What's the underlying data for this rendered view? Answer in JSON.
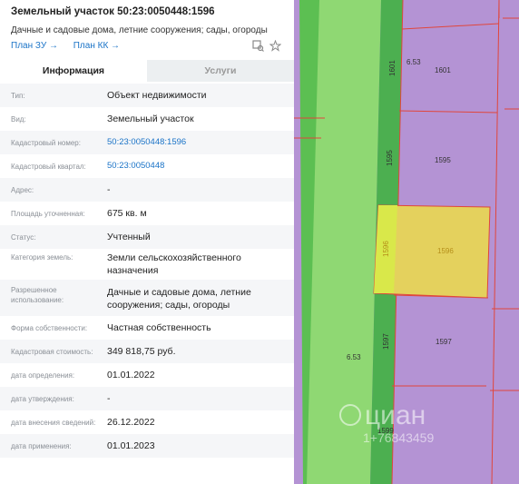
{
  "header": {
    "title": "Земельный участок 50:23:0050448:1596",
    "subtitle": "Дачные и садовые дома, летние сооружения; сады, огороды",
    "links": [
      "План ЗУ →",
      "План КК →"
    ]
  },
  "tabs": [
    {
      "label": "Информация",
      "active": true
    },
    {
      "label": "Услуги",
      "active": false
    }
  ],
  "rows": [
    {
      "label": "Тип:",
      "value": "Объект недвижимости"
    },
    {
      "label": "Вид:",
      "value": "Земельный участок"
    },
    {
      "label": "Кадастровый номер:",
      "value": "50:23:0050448:1596",
      "link": true
    },
    {
      "label": "Кадастровый квартал:",
      "value": "50:23:0050448",
      "link": true
    },
    {
      "label": "Адрес:",
      "value": "-"
    },
    {
      "label": "Площадь уточненная:",
      "value": "675 кв. м"
    },
    {
      "label": "Статус:",
      "value": "Учтенный"
    },
    {
      "label": "Категория земель:",
      "value": "Земли сельскохозяйственного назначения"
    },
    {
      "label": "Разрешенное использование:",
      "value": "Дачные и садовые дома, летние сооружения; сады, огороды"
    },
    {
      "label": "Форма собственности:",
      "value": "Частная собственность"
    },
    {
      "label": "Кадастровая стоимость:",
      "value": "349 818,75 руб."
    },
    {
      "label": "дата определения:",
      "value": "01.01.2022"
    },
    {
      "label": "дата утверждения:",
      "value": "-"
    },
    {
      "label": "дата внесения сведений:",
      "value": "26.12.2022"
    },
    {
      "label": "дата применения:",
      "value": "01.01.2023"
    }
  ],
  "map": {
    "parcels": [
      {
        "number": "1601",
        "side": "1601"
      },
      {
        "number": "1595",
        "side": "1595"
      },
      {
        "number": "1596",
        "side": "1596",
        "selected": true
      },
      {
        "number": "1597",
        "side": "1597"
      },
      {
        "number": "1599",
        "side": "1599"
      }
    ],
    "road_width_labels": [
      "6.53",
      "6.53"
    ],
    "watermark": {
      "brand": "циан",
      "number": "1+76843459"
    }
  },
  "colors": {
    "accent": "#1a73c7",
    "map_purple": "#b493d4",
    "road_green": "#8fd873",
    "road_dark_green": "#4caf50",
    "selected_parcel": "#e4d15d",
    "parcel_border": "#e0463c"
  }
}
